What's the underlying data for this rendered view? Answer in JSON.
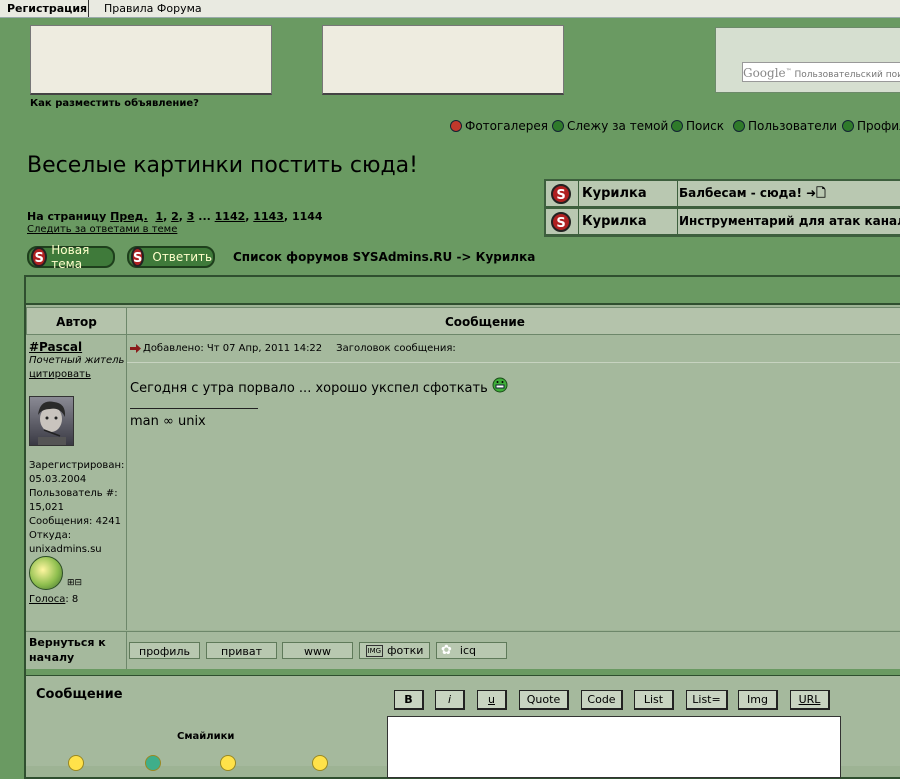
{
  "topbar": {
    "register": "Регистрация",
    "rules": "Правила Форума"
  },
  "ads": {
    "how_to": "Как разместить объявление?"
  },
  "google": {
    "logo": "Google",
    "tm": "™",
    "placeholder": "Пользовательский поиск"
  },
  "nav": [
    {
      "label": "Фотогалерея",
      "icon": "gallery-icon",
      "color": "#c0392b"
    },
    {
      "label": "Слежу за темой",
      "icon": "watch-icon",
      "color": "#2f7a2a"
    },
    {
      "label": "Поиск",
      "icon": "search-icon",
      "color": "#2f7a2a"
    },
    {
      "label": "Пользователи",
      "icon": "users-icon",
      "color": "#2f7a2a"
    },
    {
      "label": "Профиль",
      "icon": "profile-icon",
      "color": "#2f7a2a"
    }
  ],
  "page_title": "Веселые картинки постить сюда!",
  "pagination": {
    "prefix": "На страницу",
    "prev": "Пред.",
    "p1": "1",
    "p2": "2",
    "p3": "3",
    "ellipsis": "...",
    "p1142": "1142",
    "p1143": "1143",
    "p1144": "1144"
  },
  "follow_link": "Следить за ответами в теме",
  "related_topics": [
    {
      "forum": "Курилка",
      "topic": "Балбесам - сюда! ➜🗋"
    },
    {
      "forum": "Курилка",
      "topic": "Инструментарий для атак канальн"
    }
  ],
  "buttons": {
    "new_topic": "Новая тема",
    "reply": "Ответить"
  },
  "breadcrumb": "Список форумов SYSAdmins.RU -> Курилка",
  "table": {
    "author_head": "Автор",
    "message_head": "Сообщение"
  },
  "post": {
    "author": "#Pascal",
    "rank": "Почетный житель",
    "quote_link": "цитировать",
    "registered_label": "Зарегистрирован:",
    "registered": "05.03.2004",
    "user_num_label": "Пользователь #:",
    "user_num": "15,021",
    "messages_label": "Сообщения:",
    "messages": "4241",
    "from_label": "Откуда:",
    "from": "unixadmins.su",
    "pm_icons": "⊞⊟",
    "votes_label": "Голоса",
    "votes": "8",
    "added": "Добавлено: Чт 07 Апр, 2011 14:22",
    "subject_label": "Заголовок сообщения:",
    "text": "Сегодня с утра порвало ... хорошо укспел сфоткать",
    "signature": "man ∞ unix"
  },
  "footer": {
    "back": "Вернуться к началу",
    "profile": "профиль",
    "private": "приват",
    "www": "www",
    "photos": "фотки",
    "icq": "icq"
  },
  "reply_form": {
    "label": "Сообщение",
    "smilies": "Смайлики",
    "format_buttons": [
      "B",
      "i",
      "u",
      "Quote",
      "Code",
      "List",
      "List=",
      "Img",
      "URL"
    ]
  }
}
